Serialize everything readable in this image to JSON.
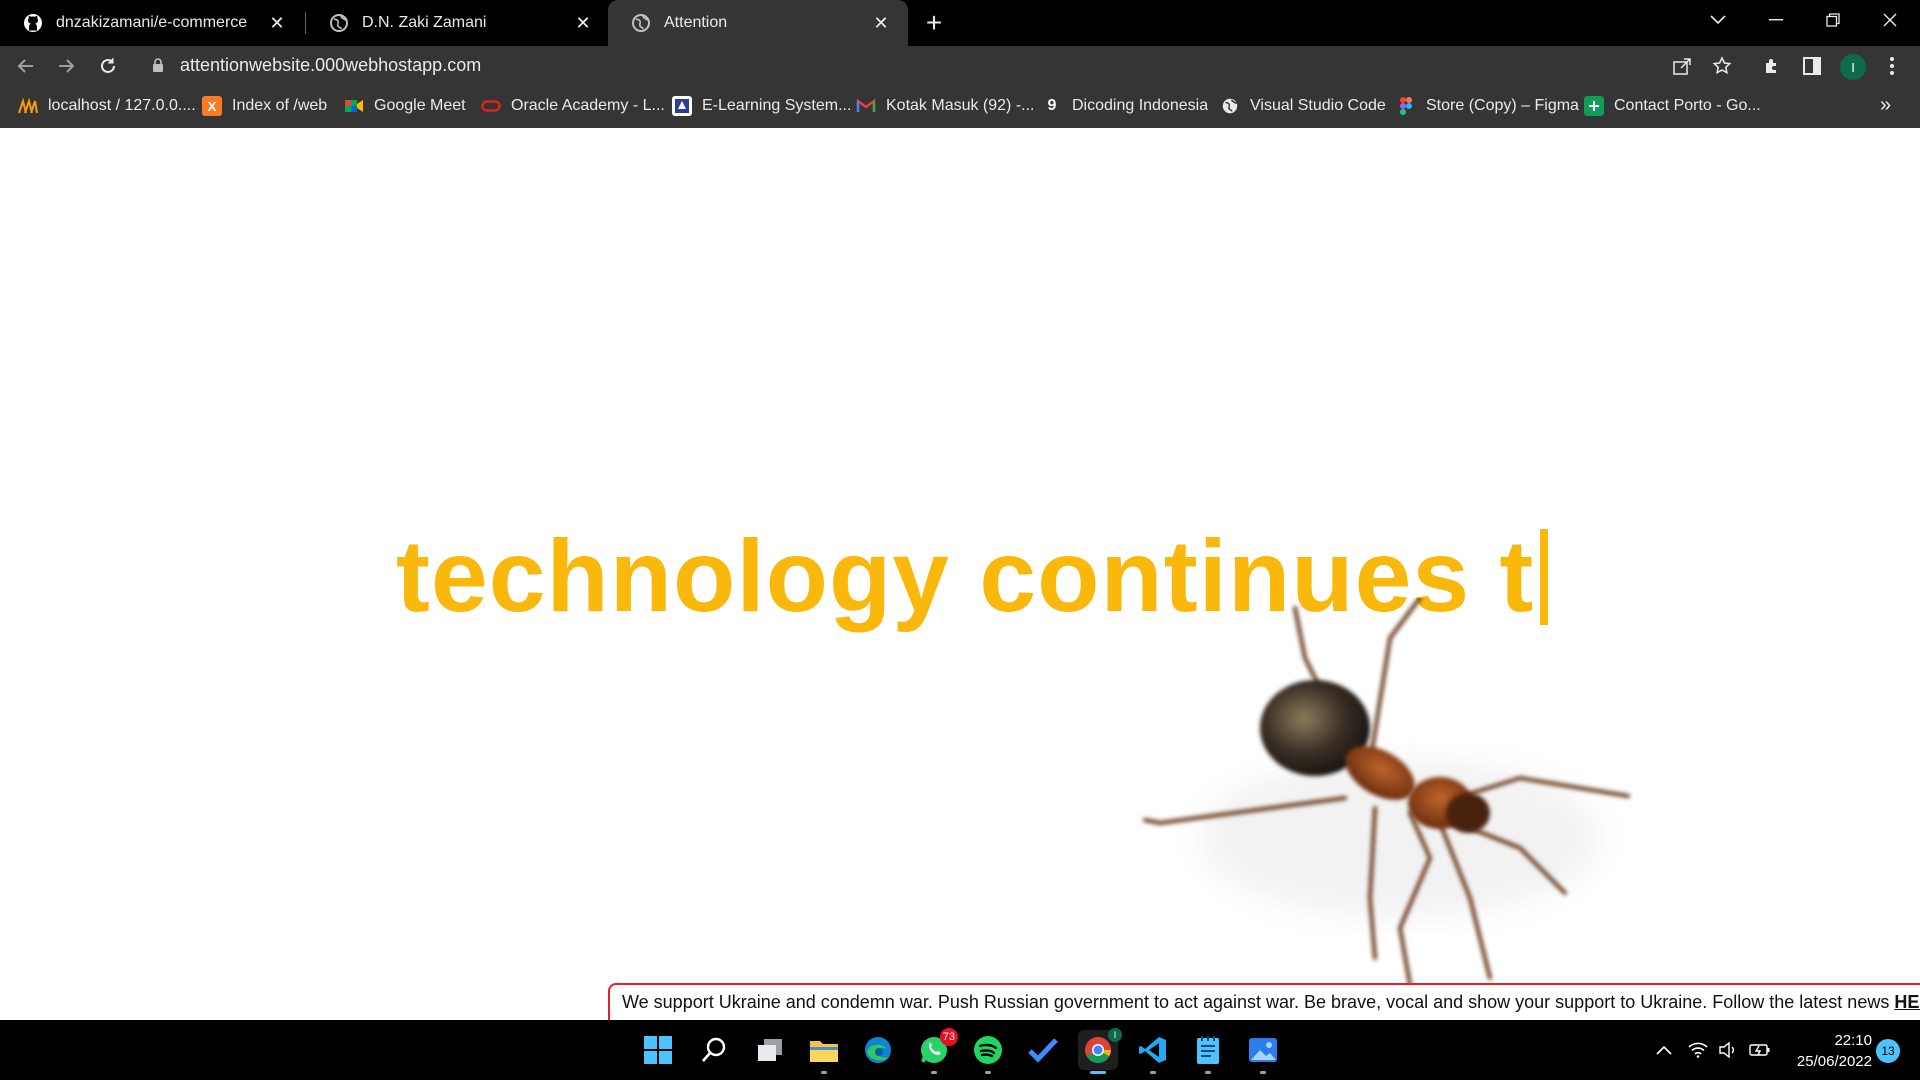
{
  "browser": {
    "tabs": [
      {
        "title": "dnzakizamani/e-commerce",
        "icon": "github-icon",
        "active": false
      },
      {
        "title": "D.N. Zaki Zamani",
        "icon": "globe-icon",
        "active": false
      },
      {
        "title": "Attention",
        "icon": "globe-icon",
        "active": true
      }
    ],
    "new_tab_label": "+",
    "url": "attentionwebsite.000webhostapp.com",
    "profile_initial": "I",
    "bookmarks": [
      {
        "label": "localhost / 127.0.0....",
        "icon": "phpmyadmin-icon"
      },
      {
        "label": "Index of /web",
        "icon": "xampp-icon"
      },
      {
        "label": "Google Meet",
        "icon": "google-meet-icon"
      },
      {
        "label": "Oracle Academy - L...",
        "icon": "oracle-icon"
      },
      {
        "label": "E-Learning System...",
        "icon": "elearning-icon"
      },
      {
        "label": "Kotak Masuk (92) -...",
        "icon": "gmail-icon"
      },
      {
        "label": "Dicoding Indonesia",
        "icon": "dicoding-icon"
      },
      {
        "label": "Visual Studio Code",
        "icon": "globe-icon"
      },
      {
        "label": "Store (Copy) – Figma",
        "icon": "figma-icon"
      },
      {
        "label": "Contact Porto - Go...",
        "icon": "google-sheets-icon"
      }
    ],
    "bookmarks_overflow": "»"
  },
  "page": {
    "headline": "technology continues t",
    "banner_text": "We support Ukraine and condemn war. Push Russian government to act against war. Be brave, vocal and show your support to Ukraine. Follow the latest news",
    "banner_link": "HERE",
    "accent_color": "#fbb80c"
  },
  "taskbar": {
    "apps": [
      {
        "name": "start-icon"
      },
      {
        "name": "search-icon"
      },
      {
        "name": "task-view-icon"
      },
      {
        "name": "file-explorer-icon"
      },
      {
        "name": "edge-icon"
      },
      {
        "name": "whatsapp-icon",
        "badge": "73"
      },
      {
        "name": "spotify-icon"
      },
      {
        "name": "todo-icon"
      },
      {
        "name": "chrome-icon"
      },
      {
        "name": "vscode-icon"
      },
      {
        "name": "notepad-icon"
      },
      {
        "name": "photos-icon"
      }
    ],
    "time": "22:10",
    "date": "25/06/2022",
    "notification_count": "13"
  }
}
